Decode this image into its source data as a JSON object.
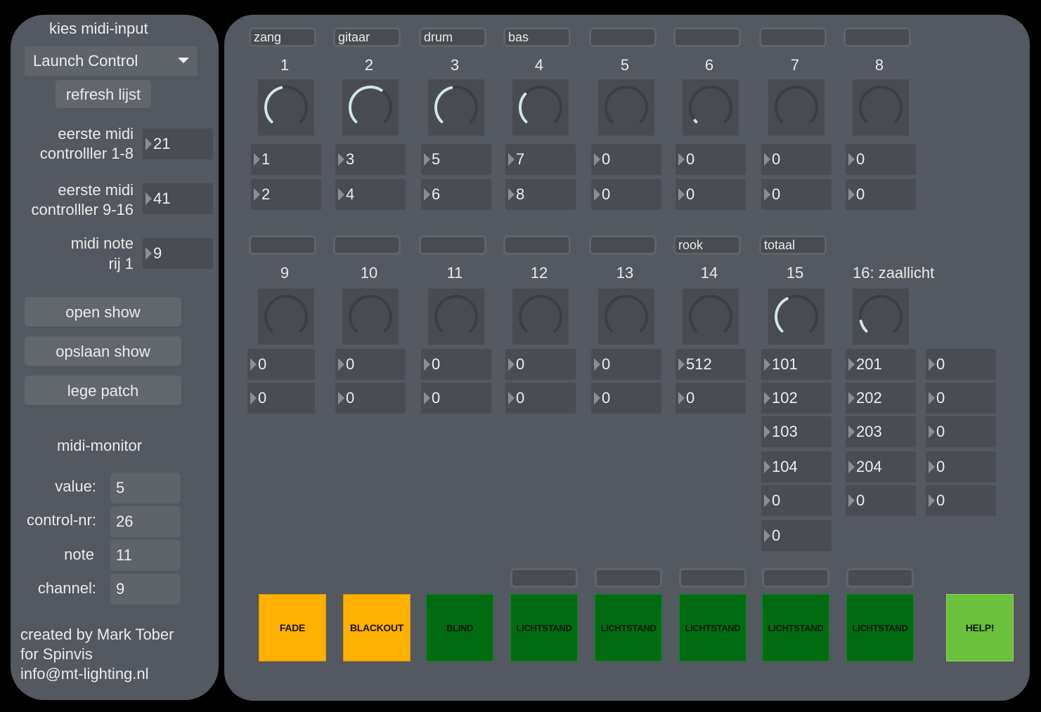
{
  "left": {
    "midi_input_label": "kies midi-input",
    "midi_input_value": "Launch Control",
    "refresh_label": "refresh lijst",
    "first_cc_1_8": {
      "line1": "eerste midi",
      "line2": "controlller 1-8",
      "value": "21"
    },
    "first_cc_9_16": {
      "line1": "eerste midi",
      "line2": "controlller 9-16",
      "value": "41"
    },
    "note_row1": {
      "line1": "midi note",
      "line2": "rij 1",
      "value": "9"
    },
    "open_show": "open show",
    "save_show": "opslaan show",
    "empty_patch": "lege patch",
    "monitor": {
      "title": "midi-monitor",
      "value_label": "value:",
      "value": "5",
      "control_label": "control-nr:",
      "control": "26",
      "note_label": "note",
      "note": "11",
      "channel_label": "channel:",
      "channel": "9"
    },
    "credits": {
      "line1": "created by Mark Tober",
      "line2": "for Spinvis",
      "line3": "info@mt-lighting.nl"
    }
  },
  "row1": [
    {
      "name": "zang",
      "num": "1",
      "a": "1",
      "b": "2",
      "level": 0.45
    },
    {
      "name": "gitaar",
      "num": "2",
      "a": "3",
      "b": "4",
      "level": 0.62
    },
    {
      "name": "drum",
      "num": "3",
      "a": "5",
      "b": "6",
      "level": 0.45
    },
    {
      "name": "bas",
      "num": "4",
      "a": "7",
      "b": "8",
      "level": 0.32
    },
    {
      "name": "",
      "num": "5",
      "a": "0",
      "b": "0",
      "level": 0
    },
    {
      "name": "",
      "num": "6",
      "a": "0",
      "b": "0",
      "level": 0.02
    },
    {
      "name": "",
      "num": "7",
      "a": "0",
      "b": "0",
      "level": 0
    },
    {
      "name": "",
      "num": "8",
      "a": "0",
      "b": "0",
      "level": 0
    }
  ],
  "row2": [
    {
      "name": "",
      "num": "9",
      "vals": [
        "0",
        "0"
      ],
      "level": 0
    },
    {
      "name": "",
      "num": "10",
      "vals": [
        "0",
        "0"
      ],
      "level": 0
    },
    {
      "name": "",
      "num": "11",
      "vals": [
        "0",
        "0"
      ],
      "level": 0
    },
    {
      "name": "",
      "num": "12",
      "vals": [
        "0",
        "0"
      ],
      "level": 0
    },
    {
      "name": "",
      "num": "13",
      "vals": [
        "0",
        "0"
      ],
      "level": 0
    },
    {
      "name": "rook",
      "num": "14",
      "vals": [
        "512",
        "0"
      ],
      "level": 0
    },
    {
      "name": "totaal",
      "num": "15",
      "vals": [
        "101",
        "102",
        "103",
        "104",
        "0",
        "0"
      ],
      "level": 0.4
    },
    {
      "name": "",
      "num": "16: zaallicht",
      "vals": [
        "201",
        "202",
        "203",
        "204",
        "0"
      ],
      "level": 0.12
    }
  ],
  "extra_column": [
    "0",
    "0",
    "0",
    "0",
    "0"
  ],
  "pads": [
    {
      "label": "FADE",
      "color": "#ffb000"
    },
    {
      "label": "BLACKOUT",
      "color": "#ffb000"
    },
    {
      "label": "BLIND",
      "color": "#006c12"
    },
    {
      "label": "LICHTSTAND",
      "color": "#006c12",
      "name": ""
    },
    {
      "label": "LICHTSTAND",
      "color": "#006c12",
      "name": ""
    },
    {
      "label": "LICHTSTAND",
      "color": "#006c12",
      "name": ""
    },
    {
      "label": "LICHTSTAND",
      "color": "#006c12",
      "name": ""
    },
    {
      "label": "LICHTSTAND",
      "color": "#006c12",
      "name": ""
    },
    {
      "label": "HELP!",
      "color": "#6cc13c"
    }
  ]
}
